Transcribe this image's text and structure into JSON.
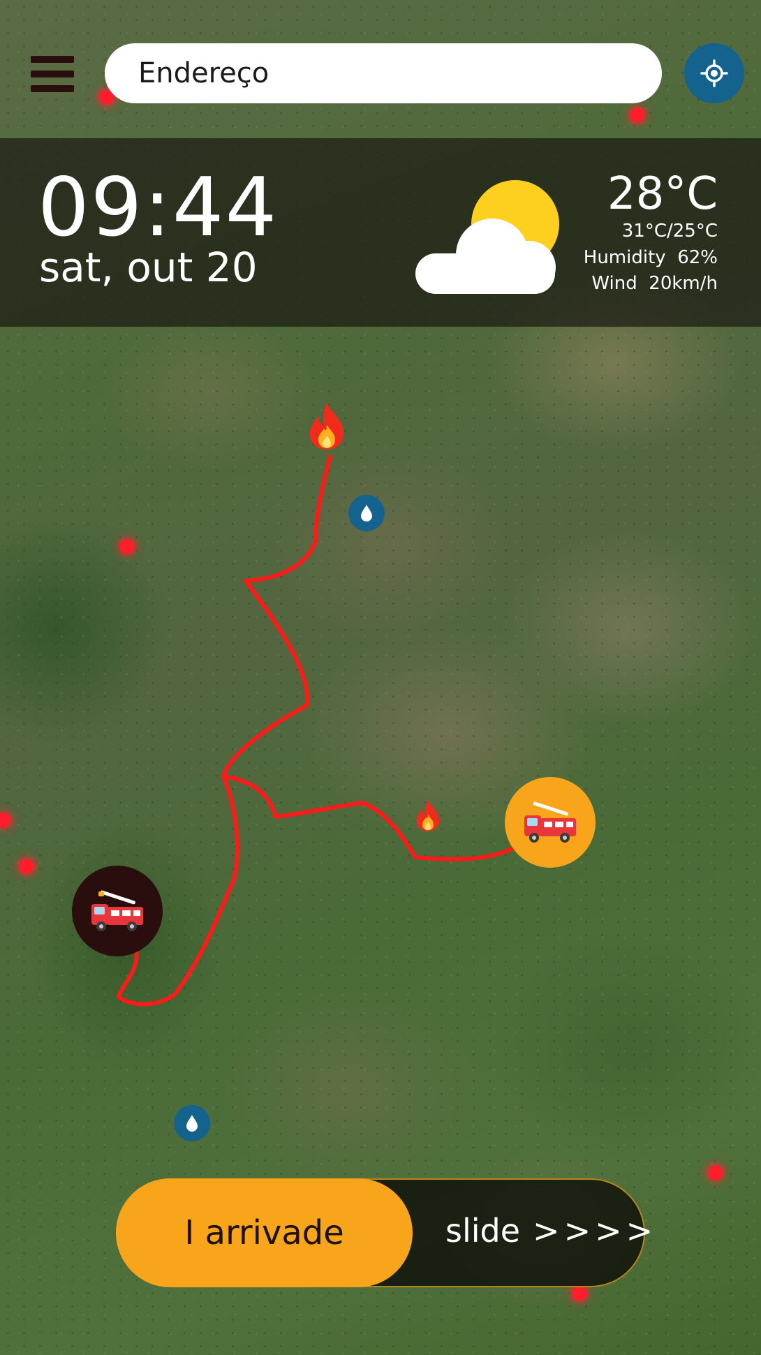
{
  "search": {
    "value": "Endereço"
  },
  "clock": {
    "time": "09:44",
    "date": "sat, out 20"
  },
  "weather": {
    "temp": "28°C",
    "minmax": "31°C/25°C",
    "humidity_label": "Humidity",
    "humidity_value": "62%",
    "wind_label": "Wind",
    "wind_value": "20km/h",
    "icon": "partly-cloudy-icon"
  },
  "map": {
    "route_color": "#ff1a1a",
    "hotspot_color": "#ff1e2a",
    "markers": [
      "fire-icon",
      "water-drop-icon",
      "fire-truck-icon"
    ]
  },
  "slider": {
    "knob_label": "I arrivade",
    "hint_label": "slide",
    "hint_arrows": ">>>>"
  },
  "colors": {
    "accent_orange": "#f9a51b",
    "accent_blue": "#14638f",
    "dark_maroon": "#2a0d0d"
  }
}
